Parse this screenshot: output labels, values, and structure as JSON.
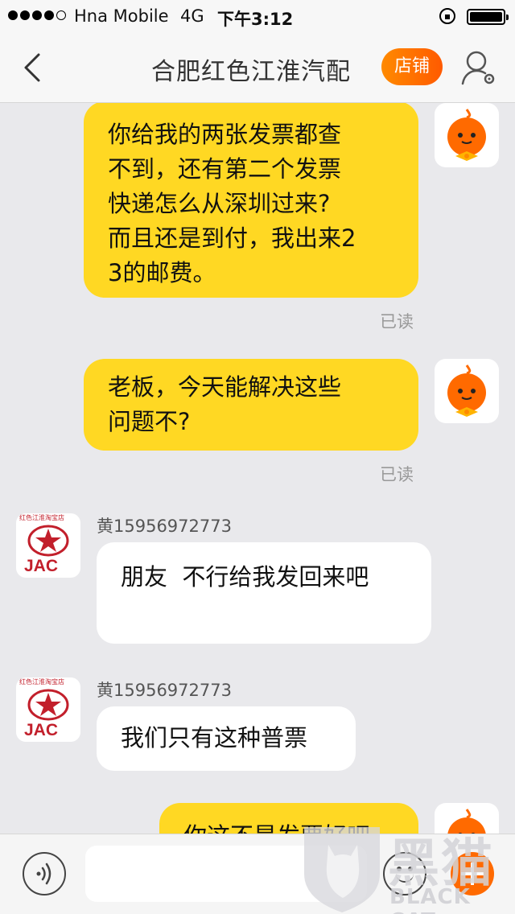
{
  "status_bar": {
    "carrier": "Hna Mobile",
    "network": "4G",
    "time": "下午3:12"
  },
  "nav": {
    "title": "合肥红色江淮汽配",
    "shop_label": "店铺"
  },
  "messages": [
    {
      "side": "out",
      "lines": [
        "你给我的两张发票都查",
        "不到，还有第二个发票",
        "快递怎么从深圳过来?",
        "而且还是到付，我出来2",
        "3的邮费。"
      ],
      "status": "已读"
    },
    {
      "side": "out",
      "lines": [
        "老板，今天能解决这些",
        "问题不?"
      ],
      "status": "已读"
    },
    {
      "side": "in",
      "sender": "黄15956972773",
      "lines": [
        "朋友  不行给我发回来吧"
      ]
    },
    {
      "side": "in",
      "sender": "黄15956972773",
      "lines": [
        "我们只有这种普票"
      ]
    },
    {
      "side": "out",
      "lines": [
        "你这不是发票好吧"
      ]
    }
  ],
  "avatar": {
    "jac_text": "JAC",
    "jac_caption": "红色江淮淘宝店"
  },
  "watermark": {
    "cn": "黑猫",
    "en": "BLACK CAT"
  },
  "colors": {
    "out_bubble": "#ffd823",
    "accent": "#ff6a00"
  }
}
